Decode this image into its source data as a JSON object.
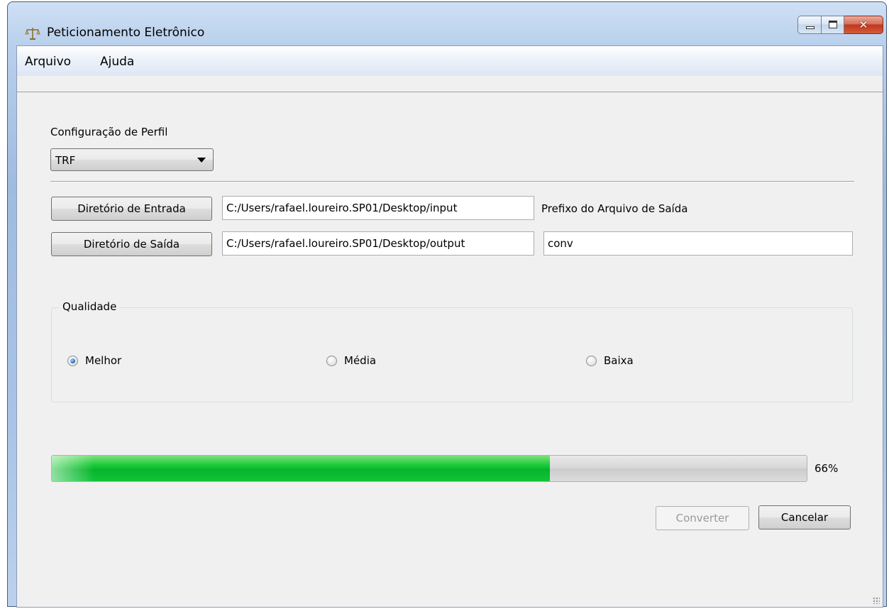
{
  "window": {
    "title": "Peticionamento Eletrônico",
    "app_icon": "scales-of-justice-icon"
  },
  "menu": {
    "items": [
      {
        "label": "Arquivo"
      },
      {
        "label": "Ajuda"
      }
    ]
  },
  "profile": {
    "label": "Configuração de Perfil",
    "selected": "TRF"
  },
  "paths": {
    "input_button": "Diretório de Entrada",
    "input_value": "C:/Users/rafael.loureiro.SP01/Desktop/input",
    "output_button": "Diretório de Saída",
    "output_value": "C:/Users/rafael.loureiro.SP01/Desktop/output",
    "prefix_label": "Prefixo do Arquivo de Saída",
    "prefix_value": "conv"
  },
  "quality": {
    "title": "Qualidade",
    "options": [
      {
        "label": "Melhor",
        "checked": true
      },
      {
        "label": "Média",
        "checked": false
      },
      {
        "label": "Baixa",
        "checked": false
      }
    ]
  },
  "progress": {
    "value": 0.66,
    "text": "66%",
    "color": "#06b52b"
  },
  "actions": {
    "convert_label": "Converter",
    "cancel_label": "Cancelar"
  }
}
